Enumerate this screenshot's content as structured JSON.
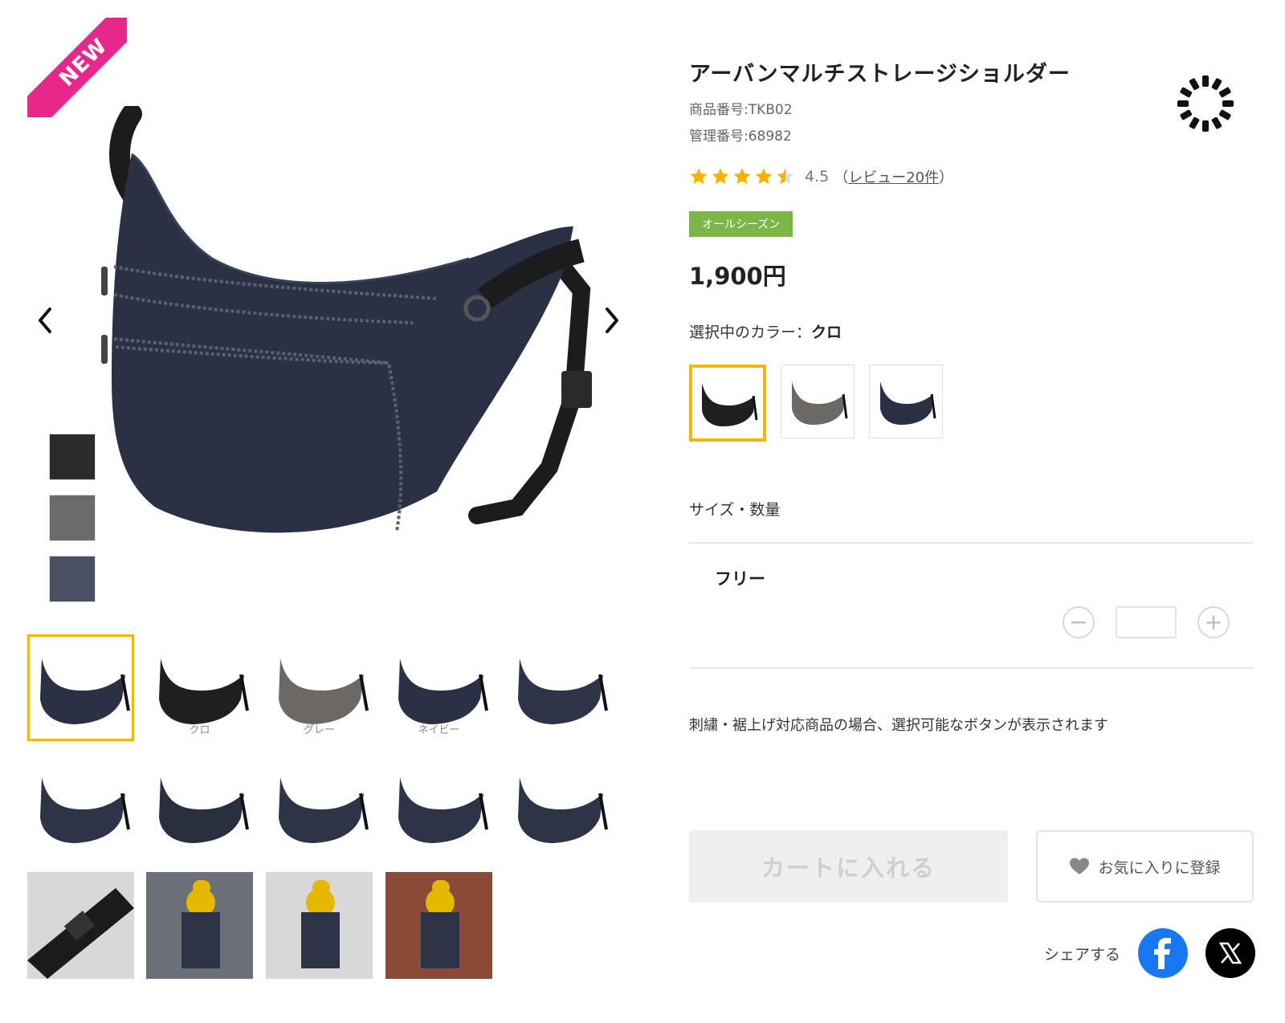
{
  "gallery": {
    "badge": "NEW",
    "prev_label": "previous-image",
    "next_label": "next-image",
    "vertical_swatches": [
      "#2b2b2b",
      "#6b6b6b",
      "#4a5064"
    ],
    "thumbnails": [
      {
        "caption": "",
        "tone": "#2a3145"
      },
      {
        "caption": "クロ",
        "tone": "#1f1f1f"
      },
      {
        "caption": "グレー",
        "tone": "#6b6866"
      },
      {
        "caption": "ネイビー",
        "tone": "#2b3145"
      },
      {
        "caption": "",
        "tone": "#2d3448"
      },
      {
        "caption": "",
        "tone": "#2d3448"
      },
      {
        "caption": "",
        "tone": "#2a2f40"
      },
      {
        "caption": "",
        "tone": "#2d3448"
      },
      {
        "caption": "",
        "tone": "#2d3448"
      },
      {
        "caption": "",
        "tone": "#2d3448"
      },
      {
        "caption": "",
        "tone": "#1b1b1b"
      },
      {
        "caption": "",
        "tone": "#5a5f6a"
      },
      {
        "caption": "",
        "tone": "#4a5058"
      },
      {
        "caption": "",
        "tone": "#7a4a3a"
      }
    ]
  },
  "product": {
    "title": "アーバンマルチストレージショルダー",
    "product_number": "商品番号:TKB02",
    "management_number": "管理番号:68982",
    "rating": "4.5",
    "review_open": "（",
    "review_link": "レビュー20件",
    "review_close": "）",
    "season_badge": "オールシーズン",
    "price": "1,900円",
    "color_label": "選択中のカラー：",
    "color_selected": "クロ",
    "colors": [
      {
        "name": "クロ",
        "hex": "#1f1f1f"
      },
      {
        "name": "グレー",
        "hex": "#6b6866"
      },
      {
        "name": "ネイビー",
        "hex": "#2b3145"
      }
    ],
    "size_qty_label": "サイズ・数量",
    "size_name": "フリー",
    "qty_minus": "−",
    "qty_plus": "+",
    "qty_value": "",
    "notice": "刺繍・裾上げ対応商品の場合、選択可能なボタンが表示されます",
    "cart_button": "カートに入れる",
    "favorite_button": "お気に入りに登録",
    "share_label": "シェアする"
  },
  "colors": {
    "accent_yellow": "#f2b705",
    "badge_green": "#7ab648",
    "new_pink": "#e8278a",
    "star": "#f5b301",
    "facebook": "#1877f2"
  }
}
